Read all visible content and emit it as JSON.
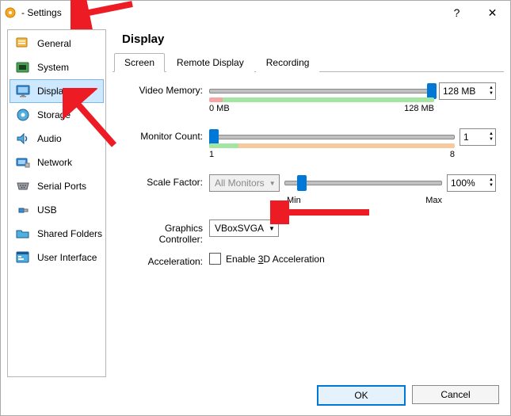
{
  "window": {
    "title": "- Settings",
    "help_symbol": "?",
    "close_symbol": "✕"
  },
  "sidebar": {
    "items": [
      {
        "key": "general",
        "label": "General"
      },
      {
        "key": "system",
        "label": "System"
      },
      {
        "key": "display",
        "label": "Display"
      },
      {
        "key": "storage",
        "label": "Storage"
      },
      {
        "key": "audio",
        "label": "Audio"
      },
      {
        "key": "network",
        "label": "Network"
      },
      {
        "key": "serial-ports",
        "label": "Serial Ports"
      },
      {
        "key": "usb",
        "label": "USB"
      },
      {
        "key": "shared-folders",
        "label": "Shared Folders"
      },
      {
        "key": "user-interface",
        "label": "User Interface"
      }
    ],
    "selected": "display"
  },
  "main": {
    "title": "Display",
    "tabs": [
      {
        "key": "screen",
        "label": "Screen"
      },
      {
        "key": "remote-display",
        "label": "Remote Display"
      },
      {
        "key": "recording",
        "label": "Recording"
      }
    ],
    "active_tab": "screen",
    "screen": {
      "video_memory": {
        "label": "Video Memory:",
        "min_label": "0 MB",
        "max_label": "128 MB",
        "value_text": "128 MB",
        "thumb_pct": 97
      },
      "monitor_count": {
        "label": "Monitor Count:",
        "min_label": "1",
        "max_label": "8",
        "value_text": "1",
        "thumb_pct": 0
      },
      "scale_factor": {
        "label": "Scale Factor:",
        "monitor_combo": "All Monitors",
        "min_label": "Min",
        "max_label": "Max",
        "value_text": "100%",
        "thumb_pct": 8
      },
      "graphics_controller": {
        "label": "Graphics Controller:",
        "value": "VBoxSVGA"
      },
      "acceleration": {
        "label": "Acceleration:",
        "checkbox_prefix": "Enable ",
        "checkbox_accel": "3",
        "checkbox_suffix": "D Acceleration",
        "checked": false
      }
    }
  },
  "footer": {
    "ok": "OK",
    "cancel": "Cancel"
  }
}
